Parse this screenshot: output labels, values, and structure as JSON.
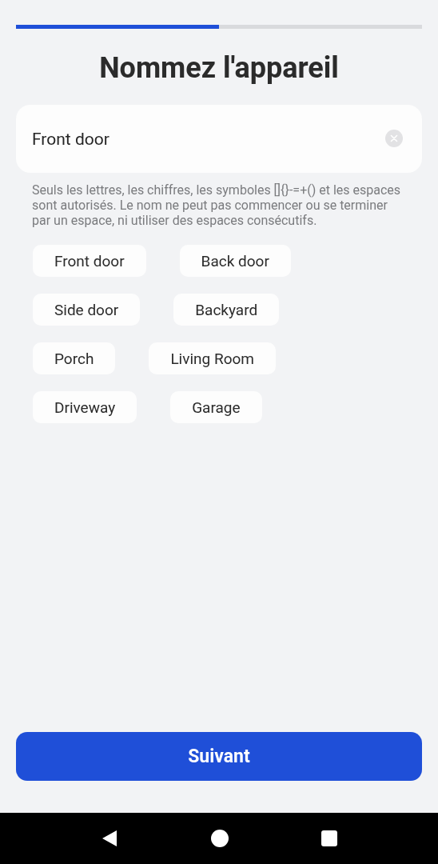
{
  "progress": {
    "level": 0.5
  },
  "title": "Nommez l'appareil",
  "name_field": {
    "value": "Front door"
  },
  "hint": "Seuls les lettres, les chiffres, les symboles []{}-=+() et les espaces sont autorisés. Le nom ne peut pas commencer ou se terminer par un espace, ni utiliser des espaces consécutifs.",
  "suggestions": [
    "Front door",
    "Back door",
    "Side door",
    "Backyard",
    "Porch",
    "Living Room",
    "Driveway",
    "Garage"
  ],
  "next_button": "Suivant"
}
